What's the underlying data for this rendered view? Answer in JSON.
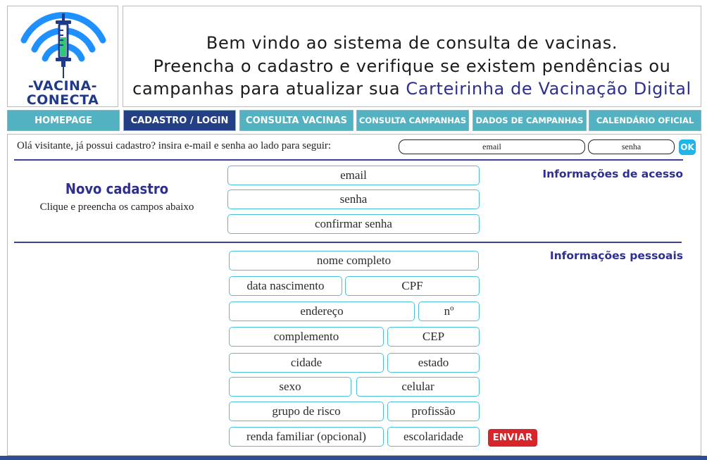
{
  "logo": {
    "line1": "-VACINA-",
    "line2": "CONECTA",
    "icon": "syringe-wifi-icon",
    "colors": {
      "wifi": "#1e90ff",
      "syringe": "#1f3a8a",
      "liquid": "#2ecc71"
    }
  },
  "welcome": {
    "line1": "Bem vindo ao sistema de consulta de vacinas.",
    "line2": "Preencha o cadastro e verifique se existem pendências ou",
    "line3_prefix": "campanhas para atualizar sua ",
    "line3_highlight": "Carteirinha de Vacinação Digital"
  },
  "nav": {
    "items": [
      {
        "label": "HOMEPAGE"
      },
      {
        "label": "CADASTRO / LOGIN"
      },
      {
        "label": "CONSULTA VACINAS"
      },
      {
        "label": "CONSULTA CAMPANHAS"
      },
      {
        "label": "DADOS DE CAMPANHAS"
      },
      {
        "label": "CALENDÁRIO OFICIAL"
      }
    ],
    "active_index": 1
  },
  "login": {
    "prompt": "Olá visitante, já possui cadastro? insira e-mail e senha ao lado para seguir:",
    "email_placeholder": "email",
    "password_placeholder": "senha",
    "ok_label": "OK"
  },
  "new_registration": {
    "title": "Novo cadastro",
    "subtitle": "Clique e preencha os campos abaixo"
  },
  "access_section": {
    "title": "Informações de acesso",
    "email": "email",
    "password": "senha",
    "confirm_password": "confirmar senha"
  },
  "personal_section": {
    "title": "Informações pessoais",
    "full_name": "nome completo",
    "birth_date": "data nascimento",
    "cpf": "CPF",
    "address": "endereço",
    "number": "nº",
    "complement": "complemento",
    "cep": "CEP",
    "city": "cidade",
    "state": "estado",
    "sex": "sexo",
    "mobile": "celular",
    "risk_group": "grupo de risco",
    "profession": "profissão",
    "family_income": "renda familiar (opcional)",
    "education": "escolaridade"
  },
  "submit_label": "ENVIAR",
  "colors": {
    "nav_bg": "#53b2c2",
    "nav_active": "#253f86",
    "accent_text": "#2e2f8f",
    "field_border": "#4cc1dc",
    "submit_bg": "#d7262b",
    "ok_bg": "#1fb4ea"
  }
}
